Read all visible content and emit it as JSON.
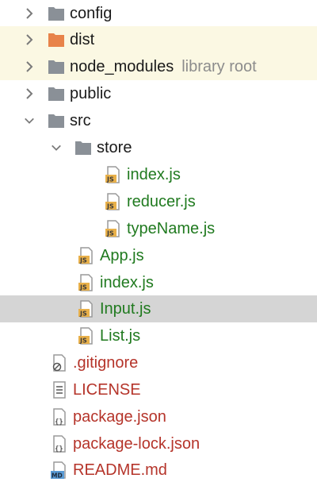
{
  "tree": {
    "items": [
      {
        "label": "config",
        "icon": "folder-icon"
      },
      {
        "label": "dist",
        "icon": "folder-excluded-icon"
      },
      {
        "label": "node_modules",
        "hint": "library root",
        "icon": "folder-icon"
      },
      {
        "label": "public",
        "icon": "folder-icon"
      },
      {
        "label": "src",
        "icon": "folder-icon"
      },
      {
        "label": "store",
        "icon": "folder-icon"
      },
      {
        "label": "index.js",
        "icon": "js-file-icon"
      },
      {
        "label": "reducer.js",
        "icon": "js-file-icon"
      },
      {
        "label": "typeName.js",
        "icon": "js-file-icon"
      },
      {
        "label": "App.js",
        "icon": "js-file-icon"
      },
      {
        "label": "index.js",
        "icon": "js-file-icon"
      },
      {
        "label": "Input.js",
        "icon": "js-file-icon"
      },
      {
        "label": "List.js",
        "icon": "js-file-icon"
      },
      {
        "label": ".gitignore",
        "icon": "gitignore-file-icon"
      },
      {
        "label": "LICENSE",
        "icon": "text-file-icon"
      },
      {
        "label": "package.json",
        "icon": "json-file-icon"
      },
      {
        "label": "package-lock.json",
        "icon": "json-file-icon"
      },
      {
        "label": "README.md",
        "icon": "markdown-file-icon"
      }
    ]
  },
  "colors": {
    "highlight_row": "#fbf8e3",
    "selected_row": "#d5d5d5",
    "js_text": "#207a1f",
    "red_text": "#b5342a",
    "hint_text": "#8c8c8c",
    "folder": "#8a9097",
    "excluded_folder": "#e8834a"
  }
}
